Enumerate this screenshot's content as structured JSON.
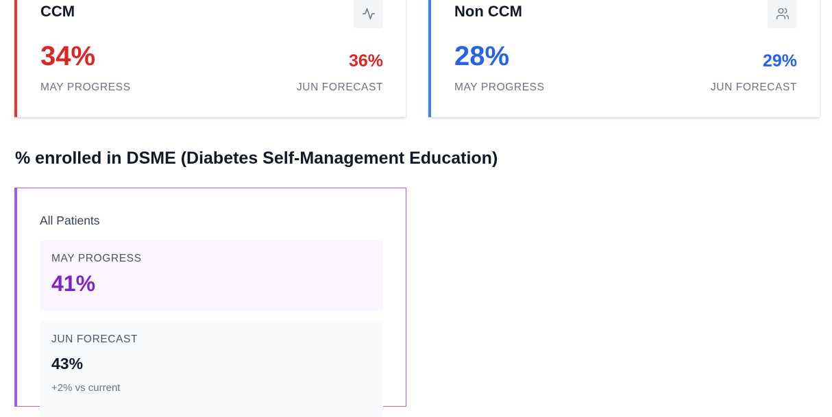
{
  "cards": [
    {
      "title": "CCM",
      "icon": "activity-icon",
      "may_value": "34%",
      "may_label": "MAY PROGRESS",
      "jun_value": "36%",
      "jun_label": "JUN FORECAST",
      "accent": "#e53935",
      "value_color": "#dc2626"
    },
    {
      "title": "Non CCM",
      "icon": "users-icon",
      "may_value": "28%",
      "may_label": "MAY PROGRESS",
      "jun_value": "29%",
      "jun_label": "JUN FORECAST",
      "accent": "#3b82f6",
      "value_color": "#2563eb"
    }
  ],
  "dsme": {
    "section_title": "% enrolled in DSME (Diabetes Self-Management Education)",
    "subtitle": "All Patients",
    "may_label": "MAY PROGRESS",
    "may_value": "41%",
    "jun_label": "JUN FORECAST",
    "jun_value": "43%",
    "jun_note": "+2% vs current",
    "accent": "#a855f7",
    "value_color": "#7e22ce"
  }
}
